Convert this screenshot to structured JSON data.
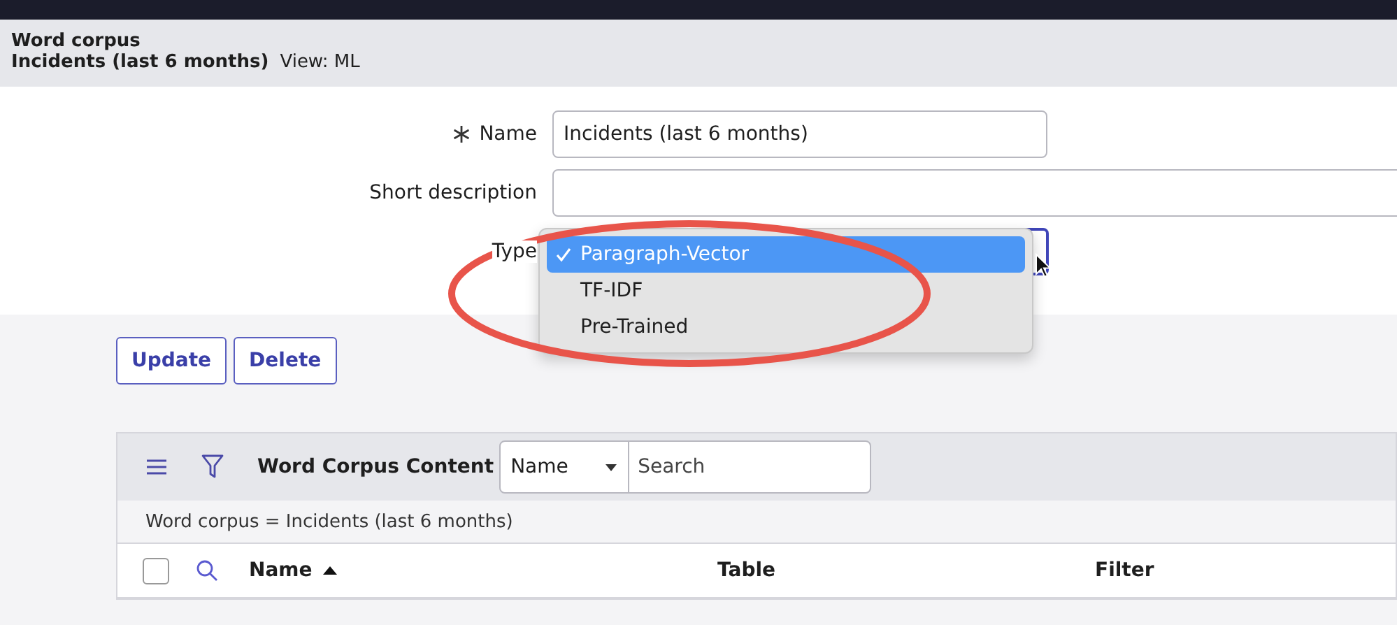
{
  "header": {
    "title": "Word corpus",
    "record": "Incidents (last 6 months)",
    "view": "View: ML"
  },
  "form": {
    "fields": [
      {
        "label": "Name",
        "required": true,
        "kind": "text",
        "value": "Incidents (last 6 months)"
      },
      {
        "label": "Short description",
        "required": false,
        "kind": "wide"
      },
      {
        "label": "Type",
        "required": false,
        "kind": "select"
      }
    ]
  },
  "dropdown": {
    "options": [
      {
        "label": "Paragraph-Vector",
        "selected": true
      },
      {
        "label": "TF-IDF",
        "selected": false
      },
      {
        "label": "Pre-Trained",
        "selected": false
      }
    ]
  },
  "buttons": [
    "Update",
    "Delete"
  ],
  "list": {
    "select_all": {
      "checked": false
    },
    "title": "Word Corpus Content",
    "search_field": "Name",
    "search": {
      "placeholder": "Search"
    },
    "breadcrumb": "Word corpus = Incidents (last 6 months)",
    "columns": [
      {
        "label": "Name",
        "sorted": true
      },
      {
        "label": "Table",
        "sorted": false
      },
      {
        "label": "Filter",
        "sorted": false
      }
    ]
  }
}
